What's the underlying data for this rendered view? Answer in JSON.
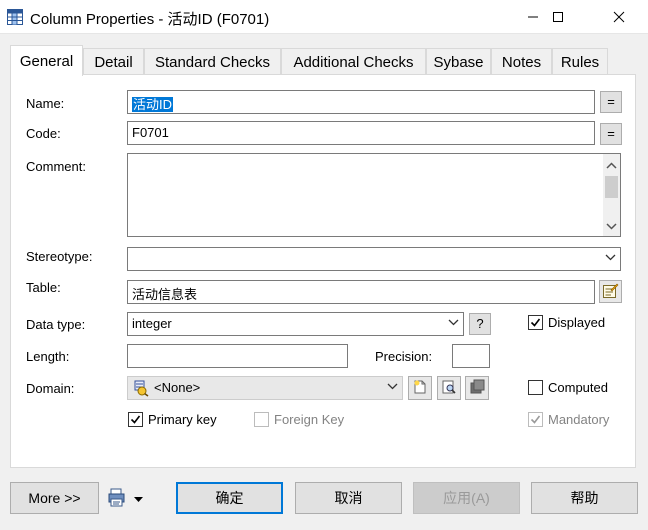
{
  "window": {
    "title": "Column Properties - 活动ID (F0701)"
  },
  "tabs": [
    {
      "label": "General"
    },
    {
      "label": "Detail"
    },
    {
      "label": "Standard Checks"
    },
    {
      "label": "Additional Checks"
    },
    {
      "label": "Sybase"
    },
    {
      "label": "Notes"
    },
    {
      "label": "Rules"
    }
  ],
  "form": {
    "name_label": "Name:",
    "name_value": "活动ID",
    "code_label": "Code:",
    "code_value": "F0701",
    "eq_label": "=",
    "comment_label": "Comment:",
    "comment_value": "",
    "stereotype_label": "Stereotype:",
    "stereotype_value": "",
    "table_label": "Table:",
    "table_value": "活动信息表",
    "datatype_label": "Data type:",
    "datatype_value": "integer",
    "datatype_help": "?",
    "displayed_label": "Displayed",
    "displayed_checked": true,
    "length_label": "Length:",
    "length_value": "",
    "precision_label": "Precision:",
    "precision_value": "",
    "domain_label": "Domain:",
    "domain_value": "<None>",
    "computed_label": "Computed",
    "computed_checked": false,
    "primary_key_label": "Primary key",
    "primary_key_checked": true,
    "foreign_key_label": "Foreign Key",
    "foreign_key_checked": false,
    "mandatory_label": "Mandatory",
    "mandatory_checked": true
  },
  "buttons": {
    "more": "More >>",
    "ok": "确定",
    "cancel": "取消",
    "apply": "应用(A)",
    "help": "帮助"
  },
  "colors": {
    "accent": "#0078d7",
    "selection": "#0078d7"
  },
  "icons": {
    "app": "column-properties-icon",
    "minimize": "minimize-icon",
    "maximize": "maximize-icon",
    "close": "close-icon",
    "table_props": "properties-icon",
    "domain": "domain-icon",
    "print": "print-icon"
  }
}
